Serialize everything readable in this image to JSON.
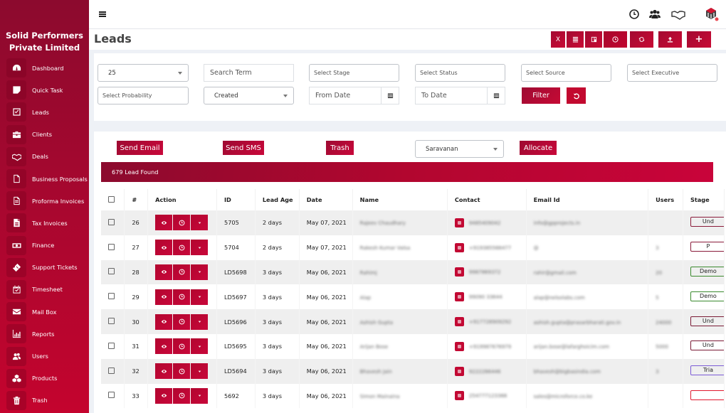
{
  "sidebar": {
    "brand_line1": "Solid Performers",
    "brand_line2": "Private Limited",
    "colors": {
      "primary": "#a8072f",
      "dark": "#8c0a2e"
    },
    "items": [
      {
        "label": "Dashboard",
        "icon": "dashboard-gauge-icon"
      },
      {
        "label": "Quick Task",
        "icon": "sticky-note-icon"
      },
      {
        "label": "Leads",
        "icon": "checkbox-icon"
      },
      {
        "label": "Clients",
        "icon": "briefcase-icon"
      },
      {
        "label": "Deals",
        "icon": "handshake-icon"
      },
      {
        "label": "Business Proposals",
        "icon": "file-icon"
      },
      {
        "label": "Proforma Invoices",
        "icon": "file-text-icon"
      },
      {
        "label": "Tax Invoices",
        "icon": "file-lines-icon"
      },
      {
        "label": "Finance",
        "icon": "money-bill-icon"
      },
      {
        "label": "Support Tickets",
        "icon": "ticket-icon"
      },
      {
        "label": "Timesheet",
        "icon": "calendar-check-icon"
      },
      {
        "label": "Mail Box",
        "icon": "envelope-icon"
      },
      {
        "label": "Reports",
        "icon": "bar-chart-icon"
      },
      {
        "label": "Users",
        "icon": "users-icon"
      },
      {
        "label": "Products",
        "icon": "cubes-icon"
      },
      {
        "label": "Trash",
        "icon": "trash-icon"
      }
    ]
  },
  "header": {
    "menu_icon": "hamburger-icon",
    "icons": [
      "clock-icon",
      "users-icon",
      "handshake-icon",
      "app-logo-icon"
    ]
  },
  "page": {
    "title": "Leads",
    "toolbar": [
      {
        "label": "X",
        "name": "export-excel-button"
      },
      {
        "label": "",
        "name": "list-view-button",
        "icon": "list-icon"
      },
      {
        "label": "",
        "name": "kanban-view-button",
        "icon": "columns-icon"
      },
      {
        "label": "",
        "name": "followup-view-button",
        "icon": "clock-icon"
      },
      {
        "label": "",
        "name": "refresh-button",
        "icon": "refresh-icon"
      },
      {
        "label": "",
        "name": "upload-button",
        "icon": "upload-icon"
      },
      {
        "label": "+",
        "name": "add-lead-button",
        "icon": "plus-icon"
      }
    ]
  },
  "filters": {
    "page_size": "25",
    "search_placeholder": "Search Term",
    "stage_placeholder": "Select Stage",
    "status_placeholder": "Select Status",
    "source_placeholder": "Select Source",
    "executive_placeholder": "Select Executive",
    "probability_placeholder": "Select Probability",
    "date_type": "Created",
    "from_date_placeholder": "From Date",
    "to_date_placeholder": "To Date",
    "filter_label": "Filter"
  },
  "actions": {
    "send_email": "Send Email",
    "send_sms": "Send SMS",
    "trash": "Trash",
    "executive": "Saravanan",
    "allocate": "Allocate"
  },
  "results": {
    "count_text": "679 Lead Found"
  },
  "table": {
    "columns": [
      "",
      "#",
      "Action",
      "ID",
      "Lead Age",
      "Date",
      "Name",
      "Contact",
      "Email Id",
      "Users",
      "Stage"
    ],
    "rows": [
      {
        "num": "26",
        "id": "5705",
        "age": "2 days",
        "date": "May 07, 2021",
        "name": "Rajeev Chaudhary",
        "contact": "9485409042",
        "email": "info@gpprojects.in",
        "users": "",
        "stage": "Und",
        "stage_color": "#8a1b3a"
      },
      {
        "num": "27",
        "id": "5704",
        "age": "2 days",
        "date": "May 07, 2021",
        "name": "Rakesh Kumar Valsa",
        "contact": "+919385566477",
        "email": "@",
        "users": "3",
        "stage": "P",
        "stage_color": "#8a1b3a"
      },
      {
        "num": "28",
        "id": "LD5698",
        "age": "3 days",
        "date": "May 06, 2021",
        "name": "Rahimj",
        "contact": "9987869372",
        "email": "rahir@gmail.com",
        "users": "20",
        "stage": "Demo",
        "stage_color": "#3a8a2e"
      },
      {
        "num": "29",
        "id": "LD5697",
        "age": "3 days",
        "date": "May 06, 2021",
        "name": "Alap",
        "contact": "99090 33644",
        "email": "alap@nelsolabs.com",
        "users": "5",
        "stage": "Demo",
        "stage_color": "#3a8a2e"
      },
      {
        "num": "30",
        "id": "LD5696",
        "age": "3 days",
        "date": "May 06, 2021",
        "name": "Ashish Gupta",
        "contact": "+917728909292",
        "email": "ashish.gupta@prasarbharati.gov.in",
        "users": "24000",
        "stage": "Und",
        "stage_color": "#7a1a35"
      },
      {
        "num": "31",
        "id": "LD5695",
        "age": "3 days",
        "date": "May 06, 2021",
        "name": "Arijan Bose",
        "contact": "+919987676979",
        "email": "arijan.bose@lafarghoicim.com",
        "users": "5000",
        "stage": "Und",
        "stage_color": "#7a1a35"
      },
      {
        "num": "32",
        "id": "LD5694",
        "age": "3 days",
        "date": "May 06, 2021",
        "name": "Bhavesh Jain",
        "contact": "9222286446",
        "email": "bhavesh@bigbasindia.com",
        "users": "3",
        "stage": "Tria",
        "stage_color": "#7b5bd6"
      },
      {
        "num": "33",
        "id": "5692",
        "age": "3 days",
        "date": "May 06, 2021",
        "name": "Simon Mainaina",
        "contact": "254777123366",
        "email": "sales@microforce.co.ke",
        "users": "",
        "stage": "",
        "stage_color": "#e0182d"
      }
    ]
  }
}
